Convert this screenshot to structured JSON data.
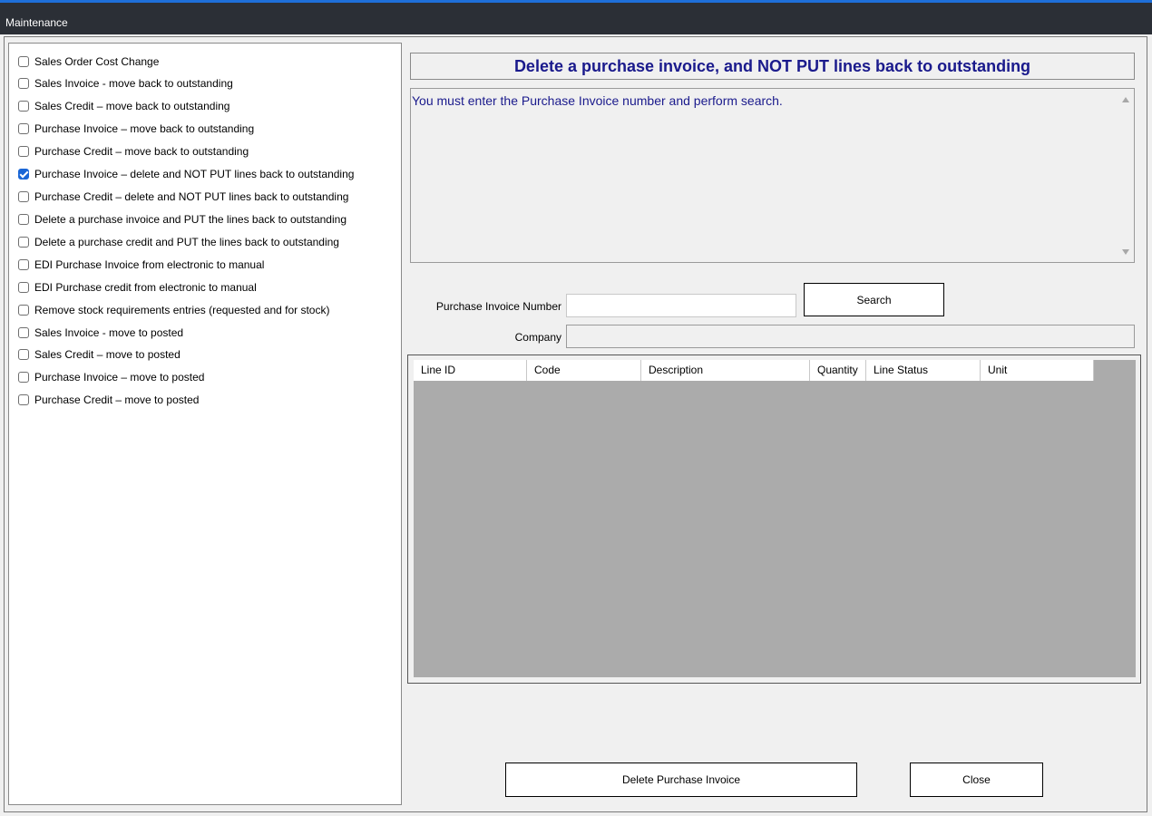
{
  "window": {
    "title": "Maintenance"
  },
  "options": [
    {
      "label": "Sales Order Cost Change",
      "checked": false
    },
    {
      "label": "Sales Invoice - move back to outstanding",
      "checked": false
    },
    {
      "label": "Sales Credit – move back to outstanding",
      "checked": false
    },
    {
      "label": "Purchase Invoice – move back to outstanding",
      "checked": false
    },
    {
      "label": "Purchase Credit – move back to outstanding",
      "checked": false
    },
    {
      "label": "Purchase Invoice – delete and NOT PUT lines back to outstanding",
      "checked": true
    },
    {
      "label": "Purchase Credit – delete and NOT PUT lines back to outstanding",
      "checked": false
    },
    {
      "label": "Delete a purchase invoice and PUT the lines back to outstanding",
      "checked": false
    },
    {
      "label": "Delete a purchase credit and PUT the lines back to outstanding",
      "checked": false
    },
    {
      "label": "EDI Purchase Invoice from electronic to manual",
      "checked": false
    },
    {
      "label": "EDI Purchase credit from electronic to manual",
      "checked": false
    },
    {
      "label": "Remove stock requirements entries (requested and for stock)",
      "checked": false
    },
    {
      "label": "Sales Invoice - move to posted",
      "checked": false
    },
    {
      "label": "Sales Credit – move to posted",
      "checked": false
    },
    {
      "label": "Purchase Invoice – move to posted",
      "checked": false
    },
    {
      "label": "Purchase Credit – move to posted",
      "checked": false
    }
  ],
  "main": {
    "heading": "Delete a purchase invoice, and NOT PUT lines back to outstanding",
    "message": "You must enter the Purchase Invoice number and perform search.",
    "invoice_label": "Purchase Invoice Number",
    "invoice_value": "",
    "search_label": "Search",
    "company_label": "Company",
    "company_value": ""
  },
  "grid": {
    "columns": [
      "Line ID",
      "Code",
      "Description",
      "Quantity",
      "Line Status",
      "Unit"
    ],
    "rows": []
  },
  "footer": {
    "delete_label": "Delete Purchase Invoice",
    "close_label": "Close"
  },
  "colors": {
    "titlebar": "#2b2f36",
    "accent": "#1a66d6",
    "heading_text": "#1a1a8c",
    "grid_empty": "#ababab"
  }
}
